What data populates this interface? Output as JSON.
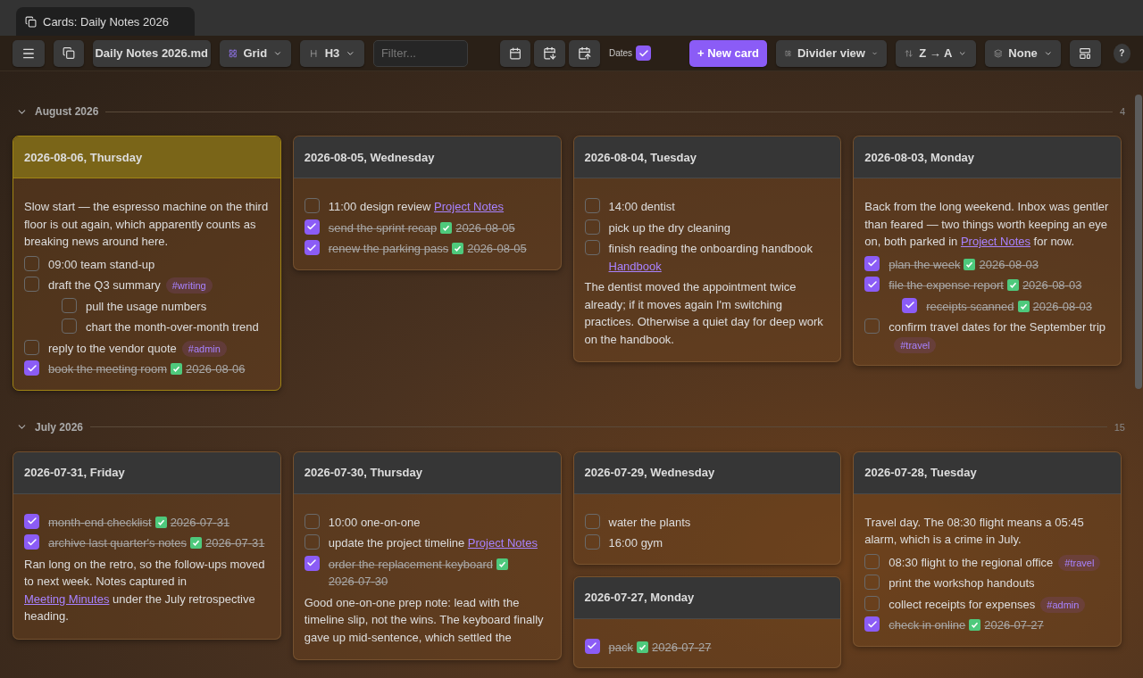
{
  "tab": {
    "title": "Cards: Daily Notes 2026",
    "selected": true
  },
  "toolbar": {
    "file": "Daily Notes 2026.md",
    "layout": "Grid",
    "heading": "H3",
    "filter": {
      "placeholder": "Filter..."
    },
    "dates": {
      "label": "Dates",
      "checked": true
    },
    "new_card": "+ New card",
    "view": "Divider view",
    "sort": "Z → A",
    "group": "None",
    "help": "?"
  },
  "groups": [
    {
      "title": "August 2026",
      "count": "4",
      "expanded": true,
      "columns": [
        [
          {
            "title": "2026-08-06, Thursday",
            "highlighted": true,
            "blocks": [
              {
                "kind": "paragraph",
                "parts": [
                  {
                    "kind": "text",
                    "text": "Slow start — the espresso machine on the third floor is out again, which apparently counts as breaking news around here."
                  }
                ]
              },
              {
                "kind": "task",
                "checked": false,
                "text": "09:00 team stand-up"
              },
              {
                "kind": "task",
                "checked": false,
                "text": "draft the Q3 summary",
                "tag": "#writing",
                "children": [
                  {
                    "kind": "task",
                    "checked": false,
                    "text": "pull the usage numbers"
                  },
                  {
                    "kind": "task",
                    "checked": false,
                    "text": "chart the month-over-month trend"
                  }
                ]
              },
              {
                "kind": "task",
                "checked": false,
                "text": "reply to the vendor quote",
                "tag": "#admin"
              },
              {
                "kind": "task",
                "checked": true,
                "text": "book the meeting room",
                "done": "2026-08-06"
              }
            ]
          }
        ],
        [
          {
            "title": "2026-08-05, Wednesday",
            "highlighted": false,
            "blocks": [
              {
                "kind": "task",
                "checked": false,
                "text": "11:00 design review",
                "link": "Project Notes"
              },
              {
                "kind": "task",
                "checked": true,
                "text": "send the sprint recap",
                "done": "2026-08-05"
              },
              {
                "kind": "task",
                "checked": true,
                "text": "renew the parking pass",
                "done": "2026-08-05"
              }
            ]
          }
        ],
        [
          {
            "title": "2026-08-04, Tuesday",
            "highlighted": false,
            "blocks": [
              {
                "kind": "task",
                "checked": false,
                "text": "14:00 dentist"
              },
              {
                "kind": "task",
                "checked": false,
                "text": "pick up the dry cleaning"
              },
              {
                "kind": "task",
                "checked": false,
                "text": "finish reading the onboarding handbook",
                "link": "Handbook"
              },
              {
                "kind": "paragraph",
                "parts": [
                  {
                    "kind": "text",
                    "text": "The dentist moved the appointment twice already; if it moves again I'm switching practices. Otherwise a quiet day for deep work on the handbook."
                  }
                ]
              }
            ]
          }
        ],
        [
          {
            "title": "2026-08-03, Monday",
            "highlighted": false,
            "blocks": [
              {
                "kind": "paragraph",
                "parts": [
                  {
                    "kind": "text",
                    "text": "Back from the long weekend. Inbox was gentler than feared — two things worth keeping an eye on, both parked in "
                  },
                  {
                    "kind": "link",
                    "text": "Project Notes"
                  },
                  {
                    "kind": "text",
                    "text": " for now."
                  }
                ]
              },
              {
                "kind": "task",
                "checked": true,
                "text": "plan the week",
                "done": "2026-08-03"
              },
              {
                "kind": "task",
                "checked": true,
                "text": "file the expense report",
                "done": "2026-08-03",
                "children": [
                  {
                    "kind": "task",
                    "checked": true,
                    "text": "receipts scanned",
                    "done": "2026-08-03"
                  }
                ]
              },
              {
                "kind": "task",
                "checked": false,
                "text": "confirm travel dates for the September trip",
                "tag": "#travel"
              }
            ]
          }
        ]
      ]
    },
    {
      "title": "July 2026",
      "count": "15",
      "expanded": true,
      "columns": [
        [
          {
            "title": "2026-07-31, Friday",
            "highlighted": false,
            "blocks": [
              {
                "kind": "task",
                "checked": true,
                "text": "month-end checklist",
                "done": "2026-07-31"
              },
              {
                "kind": "task",
                "checked": true,
                "text": "archive last quarter's notes",
                "done": "2026-07-31"
              },
              {
                "kind": "paragraph",
                "parts": [
                  {
                    "kind": "text",
                    "text": "Ran long on the retro, so the follow-ups moved to next week. Notes captured in "
                  },
                  {
                    "kind": "link",
                    "text": "Meeting Minutes"
                  },
                  {
                    "kind": "text",
                    "text": " under the July retrospective heading."
                  }
                ]
              }
            ]
          }
        ],
        [
          {
            "title": "2026-07-30, Thursday",
            "highlighted": false,
            "blocks": [
              {
                "kind": "task",
                "checked": false,
                "text": "10:00 one-on-one"
              },
              {
                "kind": "task",
                "checked": false,
                "text": "update the project timeline",
                "link": "Project Notes"
              },
              {
                "kind": "task",
                "checked": true,
                "text": "order the replacement keyboard",
                "done": "2026-07-30"
              },
              {
                "kind": "paragraph",
                "parts": [
                  {
                    "kind": "text",
                    "text": "Good one-on-one prep note: lead with the timeline slip, not the wins. The keyboard finally gave up mid-sentence, which settled the"
                  }
                ]
              }
            ]
          }
        ],
        [
          {
            "title": "2026-07-29, Wednesday",
            "highlighted": false,
            "blocks": [
              {
                "kind": "task",
                "checked": false,
                "text": "water the plants"
              },
              {
                "kind": "task",
                "checked": false,
                "text": "16:00 gym"
              }
            ]
          },
          {
            "title": "2026-07-27, Monday",
            "highlighted": false,
            "blocks": [
              {
                "kind": "task",
                "checked": true,
                "text": "pack",
                "done": "2026-07-27"
              }
            ]
          }
        ],
        [
          {
            "title": "2026-07-28, Tuesday",
            "highlighted": false,
            "blocks": [
              {
                "kind": "paragraph",
                "parts": [
                  {
                    "kind": "text",
                    "text": "Travel day. The 08:30 flight means a 05:45 alarm, which is a crime in July."
                  }
                ]
              },
              {
                "kind": "task",
                "checked": false,
                "text": "08:30 flight to the regional office",
                "tag": "#travel"
              },
              {
                "kind": "task",
                "checked": false,
                "text": "print the workshop handouts"
              },
              {
                "kind": "task",
                "checked": false,
                "text": "collect receipts for expenses",
                "tag": "#admin"
              },
              {
                "kind": "task",
                "checked": true,
                "text": "check in online",
                "done": "2026-07-27"
              }
            ]
          }
        ]
      ]
    }
  ]
}
